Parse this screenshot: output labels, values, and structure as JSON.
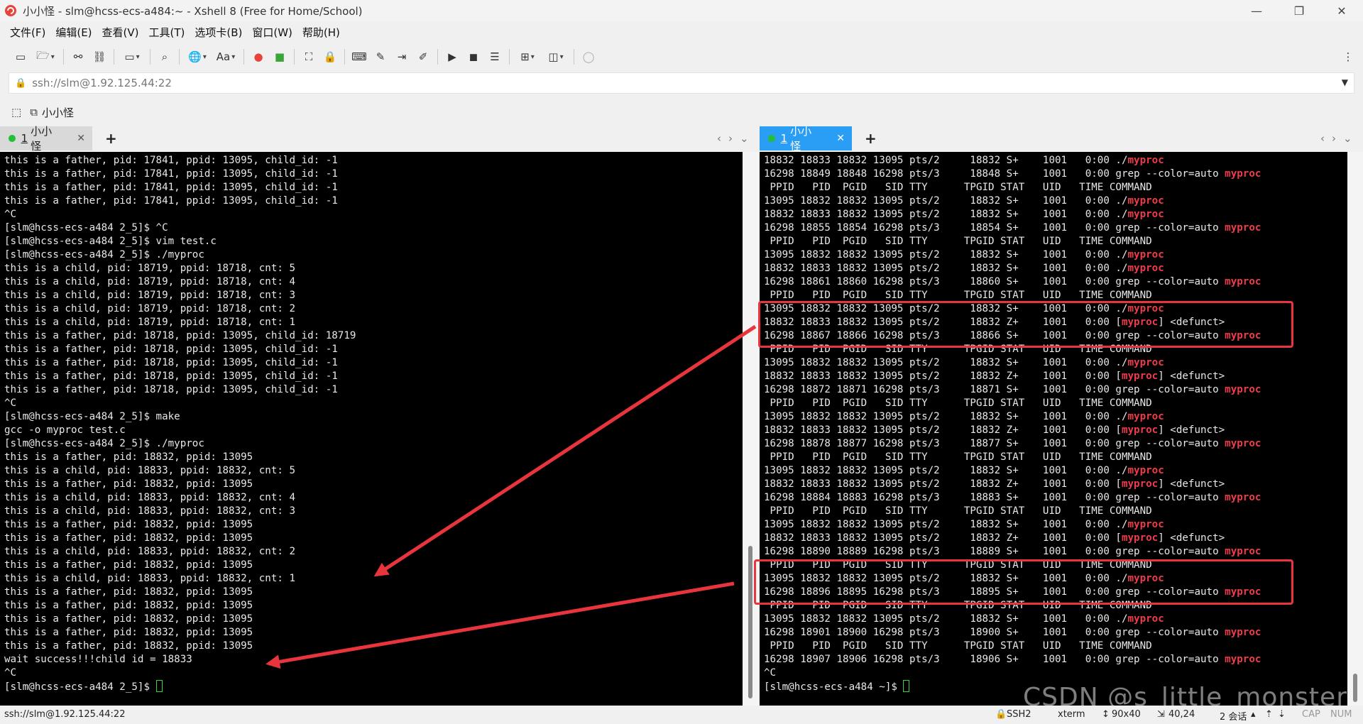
{
  "window": {
    "title": "小小怪 - slm@hcss-ecs-a484:~ - Xshell 8 (Free for Home/School)"
  },
  "menu": [
    "文件(F)",
    "编辑(E)",
    "查看(V)",
    "工具(T)",
    "选项卡(B)",
    "窗口(W)",
    "帮助(H)"
  ],
  "address": {
    "value": "ssh://slm@1.92.125.44:22"
  },
  "session_bar": {
    "label": "小小怪"
  },
  "left_tab": {
    "number": "1",
    "name": "小小怪"
  },
  "right_tab": {
    "number": "1",
    "name": "小小怪"
  },
  "left_terminal": {
    "lines": [
      "this is a father, pid: 17841, ppid: 13095, child_id: -1",
      "this is a father, pid: 17841, ppid: 13095, child_id: -1",
      "this is a father, pid: 17841, ppid: 13095, child_id: -1",
      "this is a father, pid: 17841, ppid: 13095, child_id: -1",
      "^C",
      "[slm@hcss-ecs-a484 2_5]$ ^C",
      "[slm@hcss-ecs-a484 2_5]$ vim test.c",
      "[slm@hcss-ecs-a484 2_5]$ ./myproc",
      "this is a child, pid: 18719, ppid: 18718, cnt: 5",
      "this is a child, pid: 18719, ppid: 18718, cnt: 4",
      "this is a child, pid: 18719, ppid: 18718, cnt: 3",
      "this is a child, pid: 18719, ppid: 18718, cnt: 2",
      "this is a child, pid: 18719, ppid: 18718, cnt: 1",
      "this is a father, pid: 18718, ppid: 13095, child_id: 18719",
      "this is a father, pid: 18718, ppid: 13095, child_id: -1",
      "this is a father, pid: 18718, ppid: 13095, child_id: -1",
      "this is a father, pid: 18718, ppid: 13095, child_id: -1",
      "this is a father, pid: 18718, ppid: 13095, child_id: -1",
      "^C",
      "[slm@hcss-ecs-a484 2_5]$ make",
      "gcc -o myproc test.c",
      "[slm@hcss-ecs-a484 2_5]$ ./myproc",
      "this is a father, pid: 18832, ppid: 13095",
      "this is a child, pid: 18833, ppid: 18832, cnt: 5",
      "this is a father, pid: 18832, ppid: 13095",
      "this is a child, pid: 18833, ppid: 18832, cnt: 4",
      "this is a child, pid: 18833, ppid: 18832, cnt: 3",
      "this is a father, pid: 18832, ppid: 13095",
      "this is a father, pid: 18832, ppid: 13095",
      "this is a child, pid: 18833, ppid: 18832, cnt: 2",
      "this is a father, pid: 18832, ppid: 13095",
      "this is a child, pid: 18833, ppid: 18832, cnt: 1",
      "this is a father, pid: 18832, ppid: 13095",
      "this is a father, pid: 18832, ppid: 13095",
      "this is a father, pid: 18832, ppid: 13095",
      "this is a father, pid: 18832, ppid: 13095",
      "this is a father, pid: 18832, ppid: 13095",
      "wait success!!!child id = 18833",
      "^C"
    ],
    "prompt": "[slm@hcss-ecs-a484 2_5]$ "
  },
  "right_terminal": {
    "lines": [
      "18832 18833 18832 13095 pts/2     18832 S+    1001   0:00 ./[myproc]",
      "16298 18849 18848 16298 pts/3     18848 S+    1001   0:00 grep --color=auto [myproc]",
      " PPID   PID  PGID   SID TTY      TPGID STAT   UID   TIME COMMAND",
      "13095 18832 18832 13095 pts/2     18832 S+    1001   0:00 ./[myproc]",
      "18832 18833 18832 13095 pts/2     18832 S+    1001   0:00 ./[myproc]",
      "16298 18855 18854 16298 pts/3     18854 S+    1001   0:00 grep --color=auto [myproc]",
      " PPID   PID  PGID   SID TTY      TPGID STAT   UID   TIME COMMAND",
      "13095 18832 18832 13095 pts/2     18832 S+    1001   0:00 ./[myproc]",
      "18832 18833 18832 13095 pts/2     18832 S+    1001   0:00 ./[myproc]",
      "16298 18861 18860 16298 pts/3     18860 S+    1001   0:00 grep --color=auto [myproc]",
      " PPID   PID  PGID   SID TTY      TPGID STAT   UID   TIME COMMAND",
      "13095 18832 18832 13095 pts/2     18832 S+    1001   0:00 ./[myproc]",
      "18832 18833 18832 13095 pts/2     18832 Z+    1001   0:00 [[myproc]] <defunct>",
      "16298 18867 18866 16298 pts/3     18866 S+    1001   0:00 grep --color=auto [myproc]",
      " PPID   PID  PGID   SID TTY      TPGID STAT   UID   TIME COMMAND",
      "13095 18832 18832 13095 pts/2     18832 S+    1001   0:00 ./[myproc]",
      "18832 18833 18832 13095 pts/2     18832 Z+    1001   0:00 [[myproc]] <defunct>",
      "16298 18872 18871 16298 pts/3     18871 S+    1001   0:00 grep --color=auto [myproc]",
      " PPID   PID  PGID   SID TTY      TPGID STAT   UID   TIME COMMAND",
      "13095 18832 18832 13095 pts/2     18832 S+    1001   0:00 ./[myproc]",
      "18832 18833 18832 13095 pts/2     18832 Z+    1001   0:00 [[myproc]] <defunct>",
      "16298 18878 18877 16298 pts/3     18877 S+    1001   0:00 grep --color=auto [myproc]",
      " PPID   PID  PGID   SID TTY      TPGID STAT   UID   TIME COMMAND",
      "13095 18832 18832 13095 pts/2     18832 S+    1001   0:00 ./[myproc]",
      "18832 18833 18832 13095 pts/2     18832 Z+    1001   0:00 [[myproc]] <defunct>",
      "16298 18884 18883 16298 pts/3     18883 S+    1001   0:00 grep --color=auto [myproc]",
      " PPID   PID  PGID   SID TTY      TPGID STAT   UID   TIME COMMAND",
      "13095 18832 18832 13095 pts/2     18832 S+    1001   0:00 ./[myproc]",
      "18832 18833 18832 13095 pts/2     18832 Z+    1001   0:00 [[myproc]] <defunct>",
      "16298 18890 18889 16298 pts/3     18889 S+    1001   0:00 grep --color=auto [myproc]",
      " PPID   PID  PGID   SID TTY      TPGID STAT   UID   TIME COMMAND",
      "13095 18832 18832 13095 pts/2     18832 S+    1001   0:00 ./[myproc]",
      "16298 18896 18895 16298 pts/3     18895 S+    1001   0:00 grep --color=auto [myproc]",
      " PPID   PID  PGID   SID TTY      TPGID STAT   UID   TIME COMMAND",
      "13095 18832 18832 13095 pts/2     18832 S+    1001   0:00 ./[myproc]",
      "16298 18901 18900 16298 pts/3     18900 S+    1001   0:00 grep --color=auto [myproc]",
      " PPID   PID  PGID   SID TTY      TPGID STAT   UID   TIME COMMAND",
      "16298 18907 18906 16298 pts/3     18906 S+    1001   0:00 grep --color=auto [myproc]",
      "^C"
    ],
    "prompt": "[slm@hcss-ecs-a484 ~]$ "
  },
  "statusbar": {
    "connection": "ssh://slm@1.92.125.44:22",
    "protocol": "SSH2",
    "terminal": "xterm",
    "size": "90x40",
    "cursor_pos": "40,24",
    "sessions": "2 会话",
    "cap": "CAP",
    "num": "NUM"
  },
  "watermark": "CSDN @s_little_monster",
  "colors": {
    "highlight": "#f03c4a",
    "annotation": "#e8343d",
    "cursor": "#3fd13f",
    "active_tab": "#2a9df4"
  }
}
